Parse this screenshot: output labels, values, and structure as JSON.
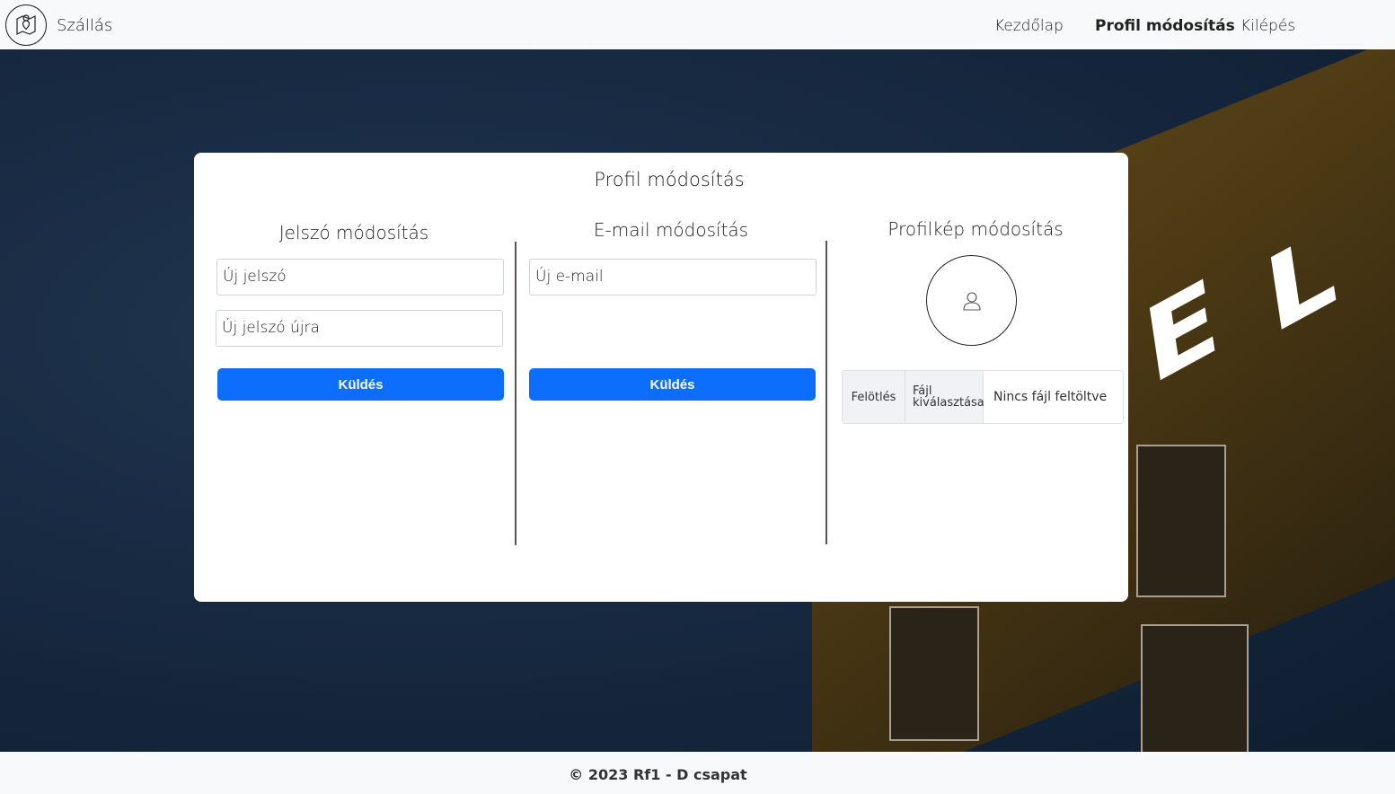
{
  "header": {
    "brand": "Szállás",
    "nav": {
      "home": "Kezdőlap",
      "profile": "Profil módosítás",
      "logout": "Kilépés"
    }
  },
  "background": {
    "sign_letters": [
      "E",
      "L"
    ]
  },
  "card": {
    "title": "Profil módosítás",
    "password": {
      "title": "Jelszó módosítás",
      "new_password": "Új jelszó",
      "new_password_again": "Új jelszó újra",
      "submit": "Küldés"
    },
    "email": {
      "title": "E-mail módosítás",
      "new_email": "Új e-mail",
      "submit": "Küldés"
    },
    "avatar": {
      "title": "Profilkép módosítás",
      "upload_button": "Felötlés",
      "choose_file": "Fájl kiválasztása",
      "no_file": "Nincs fájl feltöltve"
    }
  },
  "footer": {
    "text": "© 2023 Rf1 - D csapat"
  },
  "colors": {
    "primary": "#0d6efd",
    "navbar": "#f8f9fa"
  }
}
